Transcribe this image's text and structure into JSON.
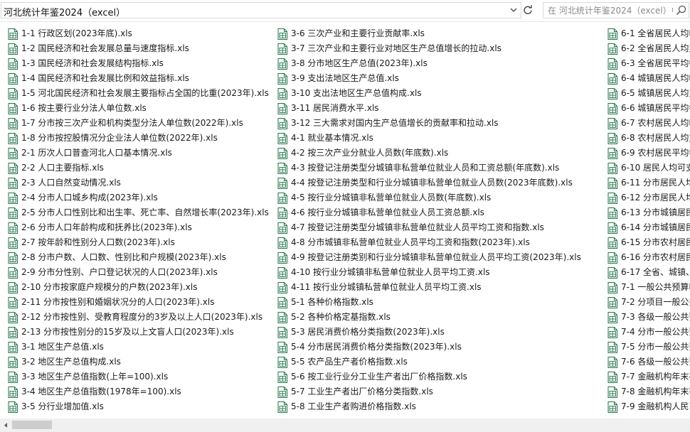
{
  "address": {
    "path": "河北统计年鉴2024（excel）"
  },
  "search": {
    "placeholder": "在 河北统计年鉴2024（excel）中搜索"
  },
  "icons": {
    "dropdown": "chevron-down-icon",
    "refresh": "refresh-icon",
    "search": "search-icon",
    "file": "excel-file-icon",
    "scroll_left": "arrow-left-icon"
  },
  "colors": {
    "excel_green": "#217346",
    "scroll_thumb": "#cdcdcd"
  },
  "columns": [
    [
      "1-1 行政区划(2023年底).xls",
      "1-2 国民经济和社会发展总量与速度指标.xls",
      "1-3 国民经济和社会发展结构指标.xls",
      "1-4 国民经济和社会发展比例和效益指标.xls",
      "1-5 河北国民经济和社会发展主要指标占全国的比重(2023年).xls",
      "1-6 按主要行业分法人单位数.xls",
      "1-7 分市按三次产业和机构类型分法人单位数(2022年).xls",
      "1-8 分市按控股情况分企业法人单位数(2022年).xls",
      "2-1 历次人口普查河北人口基本情况.xls",
      "2-2 人口主要指标.xls",
      "2-3 人口自然变动情况.xls",
      "2-4 分市人口城乡构成(2023年).xls",
      "2-5 分市人口性别比和出生率、死亡率、自然增长率(2023年).xls",
      "2-6 分市人口年龄构成和抚养比(2023年).xls",
      "2-7 按年龄和性别分人口数(2023年).xls",
      "2-8 分市户数、人口数、性别比和户规模(2023年).xls",
      "2-9 分市分性别、户口登记状况的人口(2023年).xls",
      "2-10 分市按家庭户规模分的户数(2023年).xls",
      "2-11 分市按性别和婚姻状况分的人口(2023年).xls",
      "2-12 分市按性别、受教育程度分的3岁及以上人口(2023年).xls",
      "2-13 分市按性别分的15岁及以上文盲人口(2023年).xls",
      "3-1 地区生产总值.xls",
      "3-2 地区生产总值构成.xls",
      "3-3 地区生产总值指数(上年=100).xls",
      "3-4 地区生产总值指数(1978年=100).xls",
      "3-5 分行业增加值.xls"
    ],
    [
      "3-6 三次产业和主要行业贡献率.xls",
      "3-7 三次产业和主要行业对地区生产总值增长的拉动.xls",
      "3-8 分市地区生产总值(2023年).xls",
      "3-9 支出法地区生产总值.xls",
      "3-10 支出法地区生产总值构成.xls",
      "3-11 居民消费水平.xls",
      "3-12 三大需求对国内生产总值增长的贡献率和拉动.xls",
      "4-1 就业基本情况.xls",
      "4-2 按三次产业分就业人员数(年底数).xls",
      "4-3 按登记注册类型分城镇非私营单位就业人员和工资总额(年底数).xls",
      "4-4 按登记注册类型和行业分城镇非私营单位就业人员数(2023年底数).xls",
      "4-5 按行业分城镇非私营单位就业人员数(年底数).xls",
      "4-6 按行业分城镇非私营单位就业人员工资总额.xls",
      "4-7 按登记注册类型分城镇非私营单位就业人员平均工资和指数.xls",
      "4-8 分市城镇非私营单位就业人员平均工资和指数(2023年).xls",
      "4-9 按登记注册类别和行业分城镇非私营单位就业人员平均工资(2023年).xls",
      "4-10 按行业分城镇非私营单位就业人员平均工资.xls",
      "4-11 按行业分城镇私营单位就业人员平均工资.xls",
      "5-1 各种价格指数.xls",
      "5-2 各种价格定基指数.xls",
      "5-3 居民消费价格分类指数(2023年).xls",
      "5-4 分市居民消费价格分类指数(2023年).xls",
      "5-5 农产品生产者价格指数.xls",
      "5-6 按工业行业分工业生产者出厂价格指数.xls",
      "5-7 工业生产者出厂价格分类指数.xls",
      "5-8 工业生产者购进价格指数.xls"
    ],
    [
      "6-1 全省居民人均收",
      "6-2 全省居民人均支",
      "6-3 全省居民平均每",
      "6-4 城镇居民人均收",
      "6-5 城镇居民人均支",
      "6-6 城镇居民平均每",
      "6-7 农村居民人均收",
      "6-8 农村居民人均支",
      "6-9 农村居民平均每",
      "6-10 居民人均可支",
      "6-11 分市居民人均",
      "6-12 分市居民人均",
      "6-13 分市城镇居民",
      "6-14 分市城镇居民",
      "6-15 分市农村居民",
      "6-16 分市农村居民",
      "6-17 全省、城镇、",
      "7-1 一般公共预算收",
      "7-2 分项目一般公共",
      "7-3 各级一般公共预",
      "7-4 分市一般公共预",
      "7-5 分市一般公共预",
      "7-6 各级一般公共预",
      "7-7 金融机构年末存",
      "7-8 金融机构年末存",
      "7-9 金融机构人民币"
    ]
  ]
}
